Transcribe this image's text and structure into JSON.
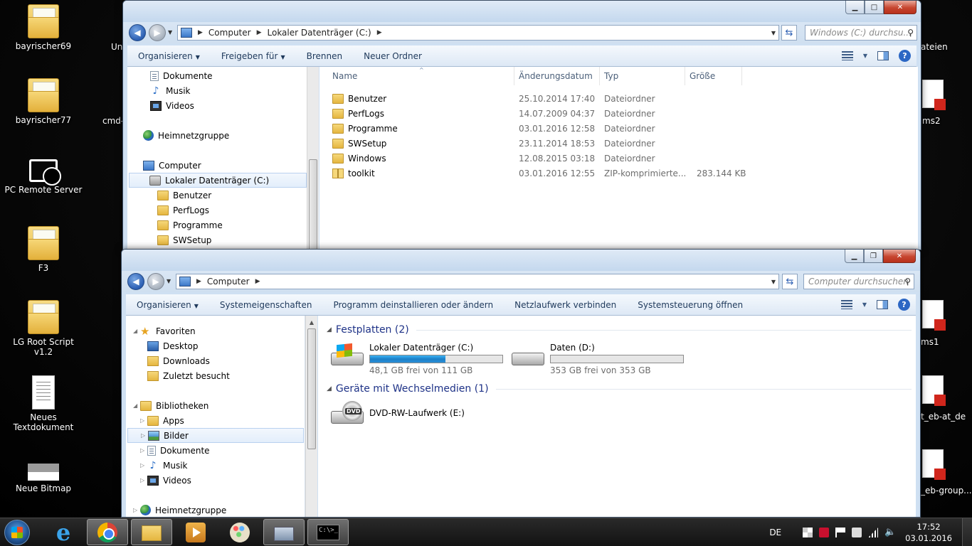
{
  "desktop": {
    "icons": [
      {
        "label": "bayrischer69",
        "type": "folder"
      },
      {
        "label": "bayrischer77",
        "type": "folder"
      },
      {
        "label": "PC Remote Server",
        "type": "app"
      },
      {
        "label": "F3",
        "type": "folder"
      },
      {
        "label": "LG Root Script v1.2",
        "type": "folder"
      },
      {
        "label": "Neues Textdokument",
        "type": "text"
      },
      {
        "label": "Neue Bitmap",
        "type": "bitmap"
      }
    ],
    "partial_labels": {
      "un": "Un",
      "cmd": "cmd-",
      "dateien": "ateien",
      "ms2": "ms2",
      "ms1": "ms1",
      "eb_at_de": "t_eb-at_de",
      "eb_group": "_eb-group..."
    }
  },
  "window1": {
    "address": {
      "seg1": "Computer",
      "seg2": "Lokaler Datenträger (C:)"
    },
    "search_placeholder": "Windows (C:) durchsu...",
    "toolbar": {
      "organize": "Organisieren",
      "share": "Freigeben für",
      "burn": "Brennen",
      "new_folder": "Neuer Ordner"
    },
    "nav_tree": [
      {
        "label": "Dokumente",
        "icon": "document-icon"
      },
      {
        "label": "Musik",
        "icon": "music-icon"
      },
      {
        "label": "Videos",
        "icon": "video-icon"
      },
      {
        "label": "Heimnetzgruppe",
        "icon": "homegroup-icon"
      },
      {
        "label": "Computer",
        "icon": "computer-icon"
      },
      {
        "label": "Lokaler Datenträger (C:)",
        "icon": "drive-icon"
      },
      {
        "label": "Benutzer",
        "icon": "folder-icon"
      },
      {
        "label": "PerfLogs",
        "icon": "folder-icon"
      },
      {
        "label": "Programme",
        "icon": "folder-icon"
      },
      {
        "label": "SWSetup",
        "icon": "folder-icon"
      }
    ],
    "columns": {
      "name": "Name",
      "date": "Änderungsdatum",
      "type": "Typ",
      "size": "Größe"
    },
    "files": [
      {
        "name": "Benutzer",
        "date": "25.10.2014 17:40",
        "type": "Dateiordner",
        "size": ""
      },
      {
        "name": "PerfLogs",
        "date": "14.07.2009 04:37",
        "type": "Dateiordner",
        "size": ""
      },
      {
        "name": "Programme",
        "date": "03.01.2016 12:58",
        "type": "Dateiordner",
        "size": ""
      },
      {
        "name": "SWSetup",
        "date": "23.11.2014 18:53",
        "type": "Dateiordner",
        "size": ""
      },
      {
        "name": "Windows",
        "date": "12.08.2015 03:18",
        "type": "Dateiordner",
        "size": ""
      },
      {
        "name": "toolkit",
        "date": "03.01.2016 12:55",
        "type": "ZIP-komprimierte...",
        "size": "283.144 KB"
      }
    ]
  },
  "window2": {
    "address": {
      "seg1": "Computer"
    },
    "search_placeholder": "Computer durchsuchen",
    "toolbar": {
      "organize": "Organisieren",
      "system_props": "Systemeigenschaften",
      "uninstall": "Programm deinstallieren oder ändern",
      "map_drive": "Netzlaufwerk verbinden",
      "control_panel": "Systemsteuerung öffnen"
    },
    "nav_tree": {
      "favorites": "Favoriten",
      "desktop": "Desktop",
      "downloads": "Downloads",
      "recent": "Zuletzt besucht",
      "libraries": "Bibliotheken",
      "apps": "Apps",
      "pictures": "Bilder",
      "documents": "Dokumente",
      "music": "Musik",
      "videos": "Videos",
      "homegroup": "Heimnetzgruppe"
    },
    "groups": {
      "hdd": "Festplatten (2)",
      "removable": "Geräte mit Wechselmedien (1)"
    },
    "drives": [
      {
        "name": "Lokaler Datenträger (C:)",
        "free": "48,1 GB frei von 111 GB",
        "used_fraction": 0.57
      },
      {
        "name": "Daten (D:)",
        "free": "353 GB frei von 353 GB",
        "used_fraction": 0.0
      }
    ],
    "dvd": {
      "name": "DVD-RW-Laufwerk (E:)",
      "badge": "DVD"
    }
  },
  "taskbar": {
    "language": "DE",
    "time": "17:52",
    "date": "03.01.2016",
    "cmd_text": "C:\\>_"
  }
}
